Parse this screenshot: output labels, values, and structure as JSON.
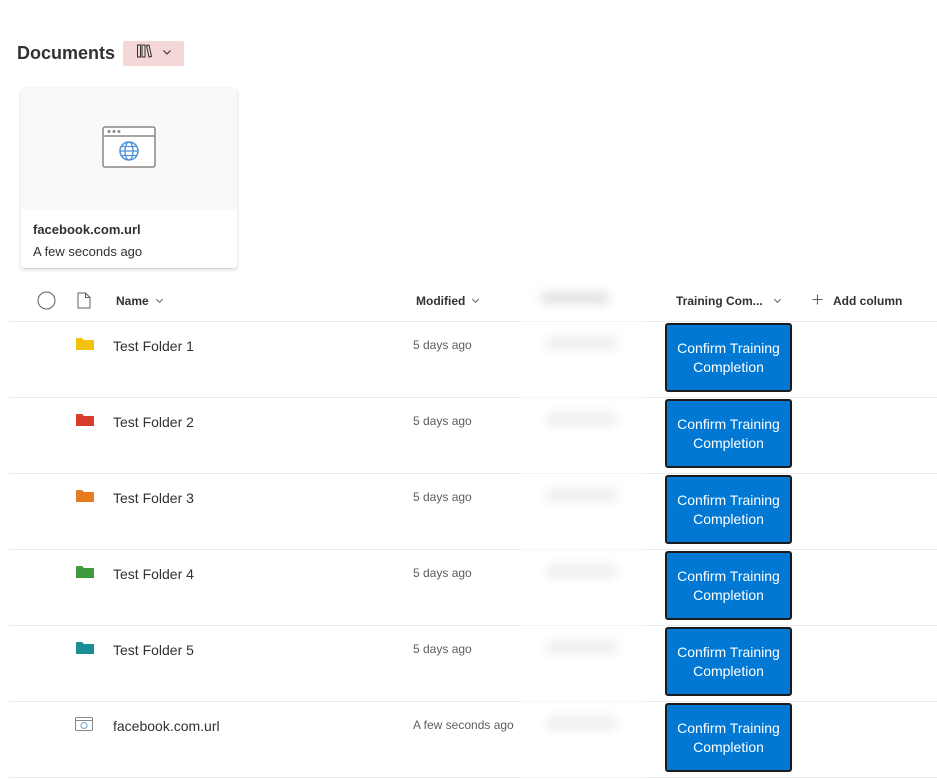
{
  "header": {
    "title": "Documents",
    "view_icon": "library-icon"
  },
  "tile": {
    "name": "facebook.com.url",
    "date": "A few seconds ago",
    "icon": "web-link-icon"
  },
  "columns": {
    "name": "Name",
    "modified": "Modified",
    "training": "Training Com...",
    "add": "Add column"
  },
  "rows": [
    {
      "name": "Test Folder 1",
      "modified": "5 days ago",
      "icon": "folder-icon",
      "color": "#f2c20c",
      "action": "Confirm Training Completion"
    },
    {
      "name": "Test Folder 2",
      "modified": "5 days ago",
      "icon": "folder-icon",
      "color": "#d83b2b",
      "action": "Confirm Training Completion"
    },
    {
      "name": "Test Folder 3",
      "modified": "5 days ago",
      "icon": "folder-icon",
      "color": "#ea7a20",
      "action": "Confirm Training Completion"
    },
    {
      "name": "Test Folder 4",
      "modified": "5 days ago",
      "icon": "folder-icon",
      "color": "#3c9a3c",
      "action": "Confirm Training Completion"
    },
    {
      "name": "Test Folder 5",
      "modified": "5 days ago",
      "icon": "folder-icon",
      "color": "#1a8f95",
      "action": "Confirm Training Completion"
    },
    {
      "name": "facebook.com.url",
      "modified": "A few seconds ago",
      "icon": "web-link-icon",
      "color": "#6ba5dc",
      "action": "Confirm Training Completion"
    }
  ]
}
